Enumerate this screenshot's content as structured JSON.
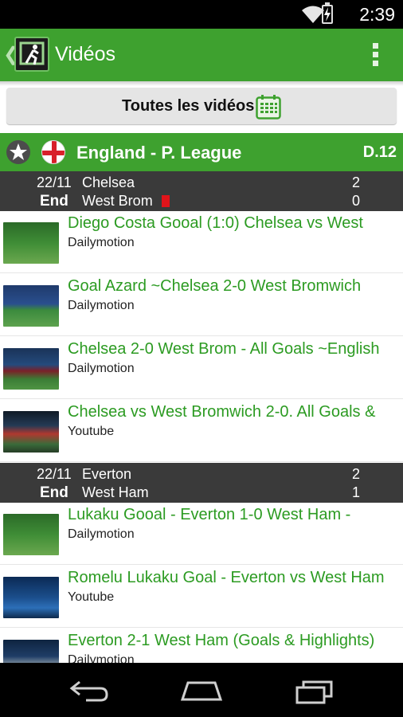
{
  "status_bar": {
    "time": "2:39"
  },
  "action_bar": {
    "title": "Vidéos"
  },
  "filter": {
    "label": "Toutes les vidéos"
  },
  "league": {
    "name": "England - P. League",
    "matchday": "D.12"
  },
  "matches": [
    {
      "date": "22/11",
      "status": "End",
      "home_team": "Chelsea",
      "away_team": "West Brom",
      "home_score": "2",
      "away_score": "0",
      "videos": [
        {
          "title": "Diego Costa Gooal (1:0) Chelsea vs West",
          "source": "Dailymotion"
        },
        {
          "title": "Goal Azard ~Chelsea 2-0 West Bromwich",
          "source": "Dailymotion"
        },
        {
          "title": "Chelsea 2-0 West Brom -  All Goals ~English",
          "source": "Dailymotion"
        },
        {
          "title": "Chelsea vs West Bromwich 2-0. All Goals &",
          "source": "Youtube"
        }
      ]
    },
    {
      "date": "22/11",
      "status": "End",
      "home_team": "Everton",
      "away_team": "West Ham",
      "home_score": "2",
      "away_score": "1",
      "videos": [
        {
          "title": "Lukaku Gooal - Everton 1-0 West Ham -",
          "source": "Dailymotion"
        },
        {
          "title": "Romelu Lukaku Goal - Everton vs West Ham",
          "source": "Youtube"
        },
        {
          "title": "Everton 2-1 West Ham (Goals & Highlights)",
          "source": "Dailymotion"
        }
      ]
    }
  ],
  "colors": {
    "accent": "#3ea12f",
    "video_title": "#2c9b22",
    "match_header": "#3a3a3a",
    "red_card": "#e0141a"
  }
}
